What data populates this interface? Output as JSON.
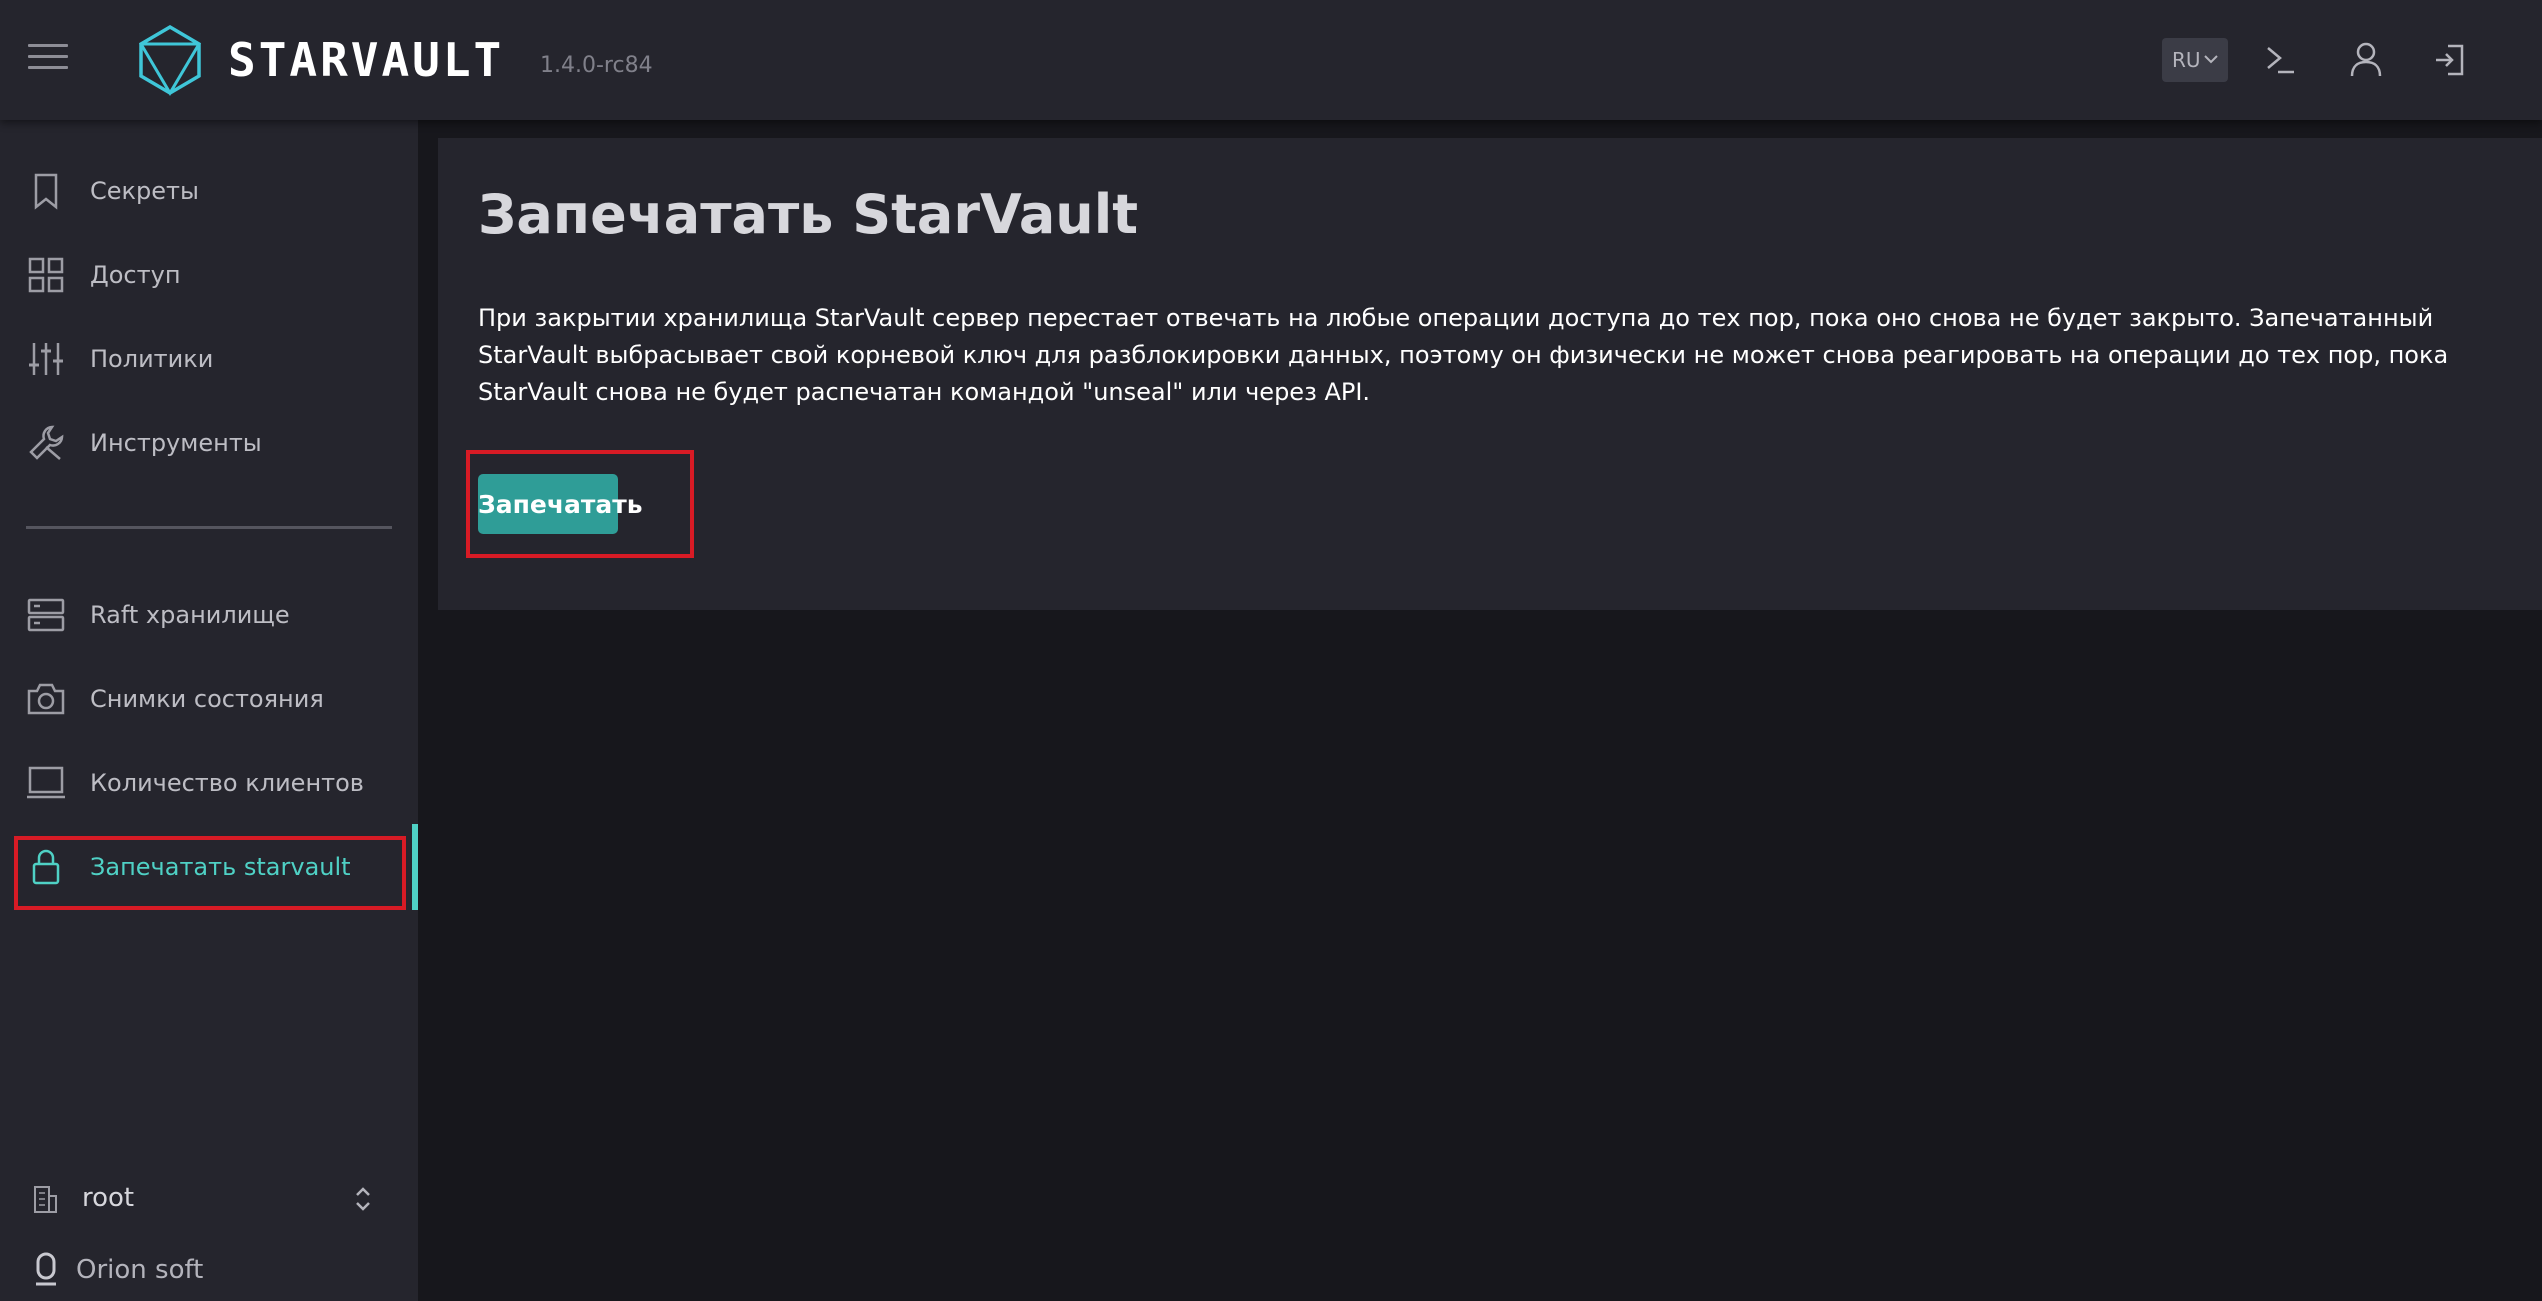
{
  "header": {
    "app_name": "STARVAULT",
    "version": "1.4.0-rc84",
    "language": "RU",
    "icons": [
      "menu-icon",
      "starvault-logo",
      "chevron-down-icon",
      "terminal-icon",
      "user-icon",
      "logout-icon"
    ]
  },
  "sidebar": {
    "items": [
      {
        "label": "Секреты",
        "icon": "bookmark-icon"
      },
      {
        "label": "Доступ",
        "icon": "grid-icon"
      },
      {
        "label": "Политики",
        "icon": "sliders-icon"
      },
      {
        "label": "Инструменты",
        "icon": "tools-icon"
      },
      {
        "label": "Raft хранилище",
        "icon": "server-icon"
      },
      {
        "label": "Снимки состояния",
        "icon": "camera-icon"
      },
      {
        "label": "Количество клиентов",
        "icon": "monitor-icon"
      },
      {
        "label": "Запечатать starvault",
        "icon": "lock-icon",
        "active": true
      }
    ],
    "namespace": "root",
    "brand": "Orion soft"
  },
  "main": {
    "title": "Запечатать StarVault",
    "description": "При закрытии хранилища StarVault сервер перестает отвечать на любые операции доступа до тех пор, пока оно снова не будет закрыто. Запечатанный StarVault выбрасывает свой корневой ключ для разблокировки данных, поэтому он физически не может снова реагировать на операции до тех пор, пока StarVault снова не будет распечатан командой \"unseal\" или через API.",
    "seal_button": "Запечатать"
  },
  "colors": {
    "accent": "#4fd1c5",
    "button": "#2f9d97",
    "highlight": "#d81b25",
    "header_bg": "#25252d",
    "page_bg": "#17171c"
  }
}
